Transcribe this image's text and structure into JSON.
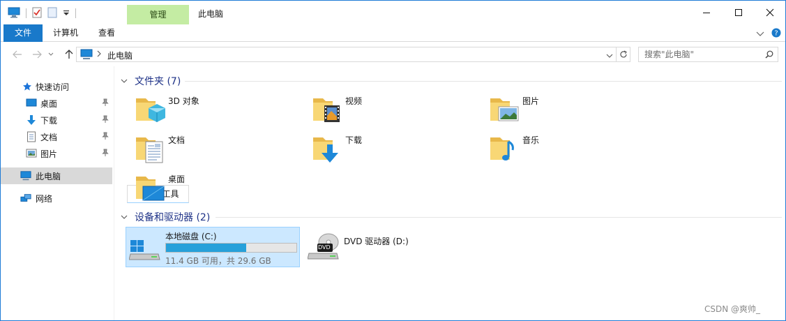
{
  "window": {
    "context_tab": "管理",
    "title": "此电脑"
  },
  "ribbon": {
    "tabs": [
      "文件",
      "计算机",
      "查看",
      "驱动器工具"
    ]
  },
  "address": {
    "path": "此电脑",
    "search_placeholder": "搜索\"此电脑\""
  },
  "nav": {
    "quick_access": "快速访问",
    "items": [
      "桌面",
      "下载",
      "文档",
      "图片"
    ],
    "this_pc": "此电脑",
    "network": "网络"
  },
  "folders": {
    "header": "文件夹 (7)",
    "items": [
      "3D 对象",
      "视频",
      "图片",
      "文档",
      "下载",
      "音乐",
      "桌面"
    ]
  },
  "devices": {
    "header": "设备和驱动器 (2)",
    "drive_c": {
      "name": "本地磁盘 (C:)",
      "usage": "11.4 GB 可用，共 29.6 GB",
      "used_fraction": 0.615
    },
    "drive_d": {
      "name": "DVD 驱动器 (D:)",
      "badge": "DVD"
    }
  },
  "watermark": "CSDN @爽帅_",
  "colors": {
    "accent": "#1979ca",
    "selection": "#cce8ff",
    "bar": "#26a0da",
    "context_tab": "#c4eca3"
  }
}
